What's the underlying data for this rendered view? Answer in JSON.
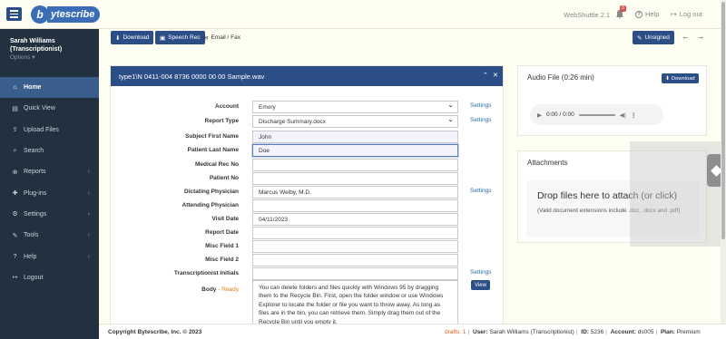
{
  "topbar": {
    "logo_mark": "b",
    "logo_text": "ytescribe",
    "version": "WebShuttle 2.1",
    "notification_count": "3",
    "help_label": "Help",
    "logout_label": "Log out"
  },
  "user": {
    "name": "Sarah Williams",
    "role": "(Transcriptionist)",
    "options_label": "Options ▾"
  },
  "nav": {
    "items": [
      {
        "label": "Home",
        "icon": "home-icon",
        "active": true
      },
      {
        "label": "Quick View",
        "icon": "quick-view-icon"
      },
      {
        "label": "Upload Files",
        "icon": "upload-icon"
      },
      {
        "label": "Search",
        "icon": "search-icon"
      },
      {
        "label": "Reports",
        "icon": "reports-icon",
        "has_submenu": true
      },
      {
        "label": "Plug-ins",
        "icon": "plugin-icon",
        "has_submenu": true
      },
      {
        "label": "Settings",
        "icon": "gear-icon",
        "has_submenu": true
      },
      {
        "label": "Tools",
        "icon": "tools-icon",
        "has_submenu": true
      },
      {
        "label": "Help",
        "icon": "help-icon",
        "has_submenu": true
      },
      {
        "label": "Logout",
        "icon": "logout-icon"
      }
    ]
  },
  "toolbar": {
    "download_label": "Download",
    "speech_rec_label": "Speech Rec",
    "email_fax_label": "Email / Fax",
    "unsigned_label": "Unsigned"
  },
  "form": {
    "title": "type1\\N 0411-004 8736 0000 00 00 Sample.wav",
    "settings_label": "Settings",
    "view_label": "View",
    "fields": {
      "account": {
        "label": "Account",
        "value": "Emory"
      },
      "report_type": {
        "label": "Report Type",
        "value": "Discharge Summary.docx"
      },
      "subject_first_name": {
        "label": "Subject First Name",
        "value": "John"
      },
      "patient_last_name": {
        "label": "Patient Last Name",
        "value": "Doe"
      },
      "medical_rec_no": {
        "label": "Medical Rec No",
        "value": ""
      },
      "patient_no": {
        "label": "Patient No",
        "value": ""
      },
      "dictating_physician": {
        "label": "Dictating Physician",
        "value": "Marcus Welby, M.D."
      },
      "attending_physician": {
        "label": "Attending Physician",
        "value": ""
      },
      "visit_date": {
        "label": "Visit Date",
        "value": "04/11/2023"
      },
      "report_date": {
        "label": "Report Date",
        "value": ""
      },
      "misc_field_1": {
        "label": "Misc Field 1",
        "value": ""
      },
      "misc_field_2": {
        "label": "Misc Field 2",
        "value": ""
      },
      "transcriptionist_initials": {
        "label": "Transcriptionist Initials",
        "value": ""
      }
    },
    "body": {
      "label": "Body",
      "status": "- Ready",
      "text": "You can delete folders and files quickly with Windows 95 by dragging them to the Recycle Bin. First, open the folder window or use Windows Explorer to locate the folder or file you want to throw away. As long as files are in the bin, you can retrieve them. Simply drag them out of the Recycle Bin until you empty it."
    }
  },
  "audio": {
    "title": "Audio File (0:26 min)",
    "download_label": "Download",
    "time": "0:00 / 0:00"
  },
  "attachments": {
    "title": "Attachments",
    "drop_text": "Drop files here to attach (or click)",
    "hint": "(Valid document extensions include .doc, .docx and .pdf)"
  },
  "footer": {
    "copyright": "Copyright Bytescribe, Inc. © 2023",
    "drafts": "drafts: 1",
    "user_label": "User:",
    "user_value": "Sarah Williams (Transcriptionist)",
    "id_label": "ID:",
    "id_value": "5236",
    "account_label": "Account:",
    "account_value": "ds005",
    "plan_label": "Plan:",
    "plan_value": "Premium"
  },
  "colors": {
    "brand": "#2c4e86",
    "sidebar": "#22313f",
    "active_nav": "#3a5e8c",
    "link": "#2c6aa8",
    "ready": "#e07b1a",
    "background": "#fffef2"
  }
}
